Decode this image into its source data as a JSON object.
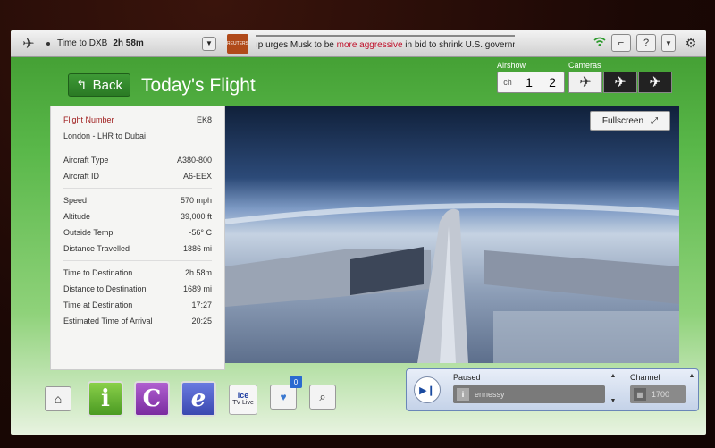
{
  "topbar": {
    "destination_label": "Time to DXB",
    "destination_time": "2h 58m",
    "news_source": "REUTERS",
    "ticker_prefix": "ıp urges Musk to be ",
    "ticker_highlight": "more aggressive",
    "ticker_suffix": " in bid to shrink U.S. government"
  },
  "header": {
    "back_label": "Back",
    "title": "Today's Flight"
  },
  "airshow": {
    "label": "Airshow",
    "ch_label": "ch",
    "channels": [
      "1",
      "2"
    ]
  },
  "cameras": {
    "label": "Cameras"
  },
  "flight_info": {
    "group1": [
      {
        "label": "Flight Number",
        "value": "EK8"
      },
      {
        "label": "London - LHR to Dubai",
        "value": ""
      }
    ],
    "group2": [
      {
        "label": "Aircraft Type",
        "value": "A380-800"
      },
      {
        "label": "Aircraft ID",
        "value": "A6-EEX"
      }
    ],
    "group3": [
      {
        "label": "Speed",
        "value": "570 mph"
      },
      {
        "label": "Altitude",
        "value": "39,000 ft"
      },
      {
        "label": "Outside Temp",
        "value": "-56° C"
      },
      {
        "label": "Distance Travelled",
        "value": "1886 mi"
      }
    ],
    "group4": [
      {
        "label": "Time to Destination",
        "value": "2h 58m"
      },
      {
        "label": "Distance to Destination",
        "value": "1689 mi"
      },
      {
        "label": "Time at Destination",
        "value": "17:27"
      },
      {
        "label": "Estimated Time of Arrival",
        "value": "20:25"
      }
    ]
  },
  "camera_view": {
    "fullscreen_label": "Fullscreen"
  },
  "bottom": {
    "tv_live_brand": "ice",
    "tv_live_label": "TV Live",
    "favorites_count": "0"
  },
  "player": {
    "status": "Paused",
    "track": "ennessy",
    "channel_label": "Channel",
    "channel_value": "1700"
  },
  "colors": {
    "accent_green": "#2a7a24",
    "ticker_red": "#c0102a",
    "player_blue": "#6a86b8"
  }
}
